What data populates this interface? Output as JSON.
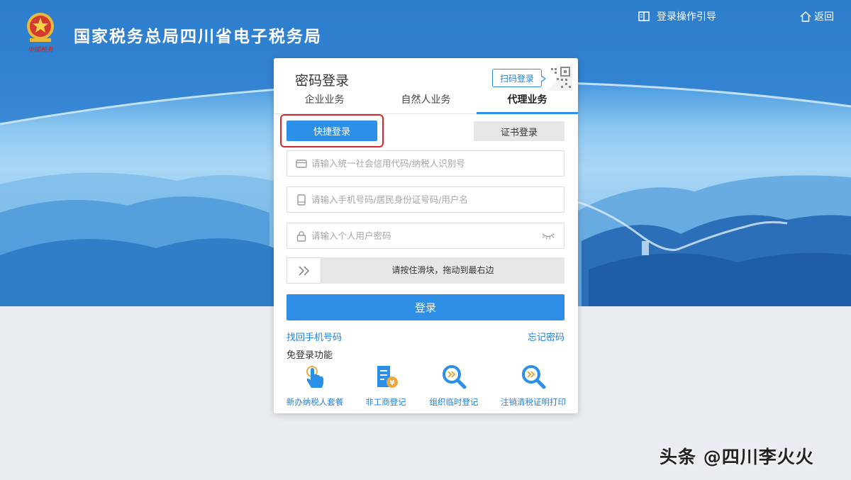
{
  "header": {
    "site_title": "国家税务总局四川省电子税务局",
    "guide_label": "登录操作引导",
    "back_label": "返回"
  },
  "login": {
    "title": "密码登录",
    "scan_label": "扫码登录",
    "tabs": [
      {
        "label": "企业业务",
        "active": false
      },
      {
        "label": "自然人业务",
        "active": false
      },
      {
        "label": "代理业务",
        "active": true
      }
    ],
    "modes": {
      "quick_label": "快捷登录",
      "cert_label": "证书登录"
    },
    "fields": {
      "credit_code_placeholder": "请输入统一社会信用代码/纳税人识别号",
      "account_placeholder": "请输入手机号码/居民身份证号码/用户名",
      "password_placeholder": "请输入个人用户密码"
    },
    "slider_text": "请按住滑块，拖动到最右边",
    "submit_label": "登录",
    "recover_phone": "找回手机号码",
    "forgot_password": "忘记密码",
    "free_section_title": "免登录功能",
    "free_items": [
      {
        "label": "新办纳税人套餐",
        "icon": "hand-pointer-icon"
      },
      {
        "label": "非工商登记",
        "icon": "document-yuan-icon"
      },
      {
        "label": "组织临时登记",
        "icon": "magnifier-icon"
      },
      {
        "label": "注销清税证明打印",
        "icon": "magnifier-icon"
      }
    ]
  },
  "watermark": "头条 @四川李火火",
  "colors": {
    "primary": "#2c8fe8",
    "highlight": "#d9262c",
    "banner": "#3f95de"
  }
}
